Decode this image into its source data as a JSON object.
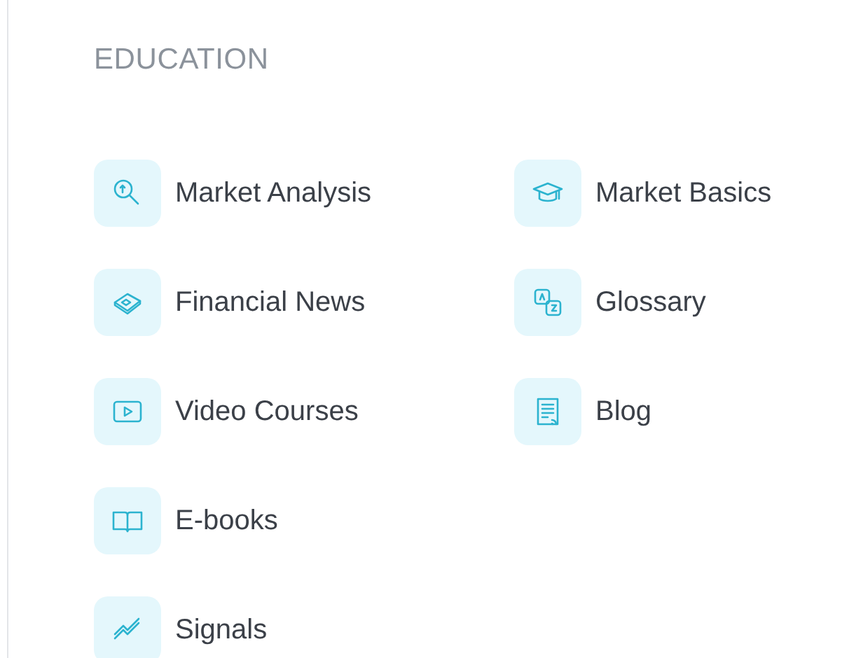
{
  "section": {
    "title": "EDUCATION"
  },
  "items": [
    {
      "label": "Market Analysis",
      "kind": "analysis"
    },
    {
      "label": "Market Basics",
      "kind": "course"
    },
    {
      "label": "Financial News",
      "kind": "news"
    },
    {
      "label": "Glossary",
      "kind": "glossary"
    },
    {
      "label": "Video Courses",
      "kind": "video"
    },
    {
      "label": "Blog",
      "kind": "blog"
    },
    {
      "label": "E-books",
      "kind": "ebook"
    },
    {
      "label": "Signals",
      "kind": "signals"
    }
  ]
}
